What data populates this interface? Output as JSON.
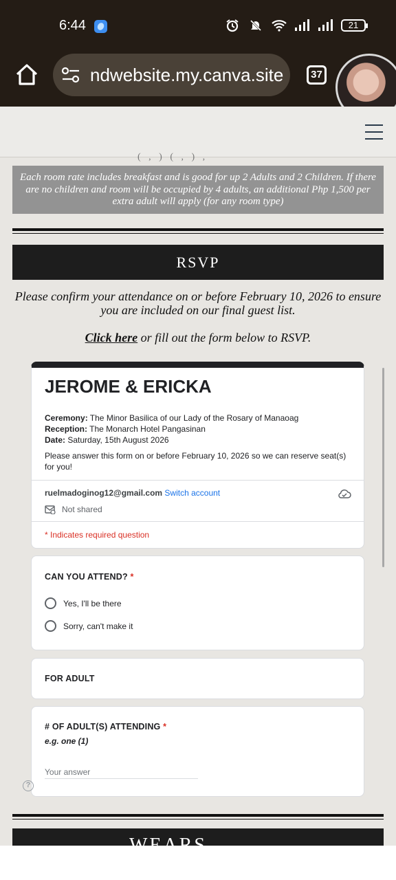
{
  "status_bar": {
    "time": "6:44",
    "battery": "21"
  },
  "browser": {
    "url": "ndwebsite.my.canva.site",
    "tab_count": "37"
  },
  "page": {
    "cut_text": "( , ) ( , ) ,",
    "note": "Each room rate includes breakfast and is good for up 2 Adults and 2 Children. If there are no children and room will be occupied by 4 adults, an additional Php 1,500 per extra adult will apply (for any room type)",
    "rsvp_heading": "RSVP",
    "confirm_text": "Please confirm your attendance on or before February 10, 2026 to ensure you are included on our final guest list.",
    "click_here": "Click here",
    "click_rest": " or fill out the form below to RSVP.",
    "bottom_heading": "WEARS"
  },
  "form": {
    "title": "JEROME & ERICKA",
    "ceremony_label": "Ceremony:",
    "ceremony_value": " The Minor Basilica of our Lady of the Rosary of Manaoag",
    "reception_label": "Reception:",
    "reception_value": " The Monarch Hotel Pangasinan",
    "date_label": "Date:",
    "date_value": " Saturday, 15th August 2026",
    "description": "Please answer this form on or before February 10, 2026 so we can reserve seat(s) for you!",
    "email": "ruelmadoginog12@gmail.com",
    "switch_account": "Switch account",
    "not_shared": "Not shared",
    "required_note": "* Indicates required question",
    "q1": {
      "title": "CAN YOU ATTEND?",
      "star": "*",
      "options": [
        "Yes,  I'll be there",
        "Sorry, can't make it"
      ]
    },
    "section_title": "FOR ADULT",
    "q2": {
      "title": "# OF ADULT(S) ATTENDING",
      "star": "*",
      "subtitle": "e.g. one (1)",
      "placeholder": "Your answer"
    }
  }
}
